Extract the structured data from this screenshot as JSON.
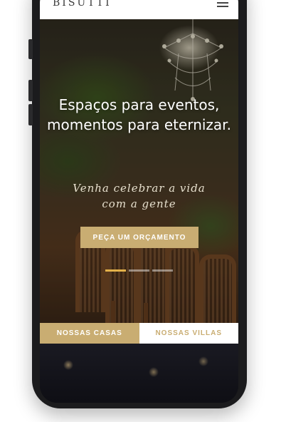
{
  "header": {
    "logo": "BISUTTI",
    "menu_icon": "hamburger-menu-icon"
  },
  "hero": {
    "title_line1": "Espaços para eventos,",
    "title_line2": "momentos para eternizar.",
    "script_line1": "Venha celebrar a vida",
    "script_line2": "com a gente",
    "cta_label": "PEÇA UM ORÇAMENTO",
    "slides": {
      "count": 3,
      "active_index": 0
    },
    "scroll_icon": "chevron-down-icon"
  },
  "tabs": {
    "casas_label": "NOSSAS CASAS",
    "villas_label": "NOSSAS VILLAS",
    "active": "casas"
  },
  "colors": {
    "accent": "#c9ad72",
    "active_dot": "#e3b14a",
    "header_bg": "#ffffff"
  }
}
